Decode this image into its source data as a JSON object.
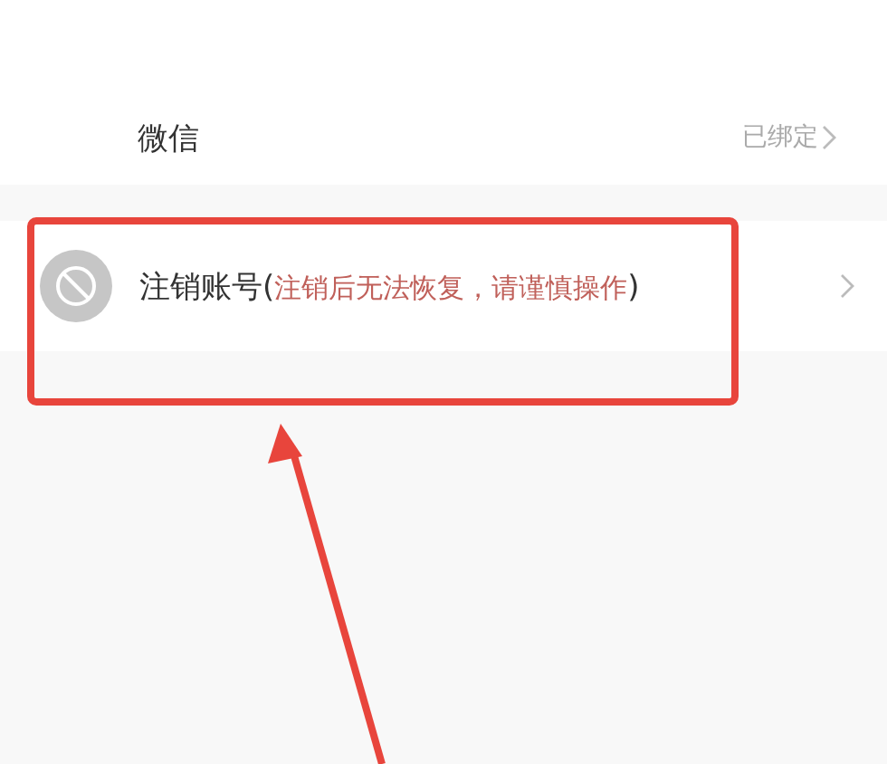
{
  "bindings": [
    {
      "name": "微信",
      "status": "已绑定"
    }
  ],
  "delete_account": {
    "label": "注销账号",
    "open": "(",
    "note": "注销后无法恢复，请谨慎操作",
    "close": ")"
  }
}
